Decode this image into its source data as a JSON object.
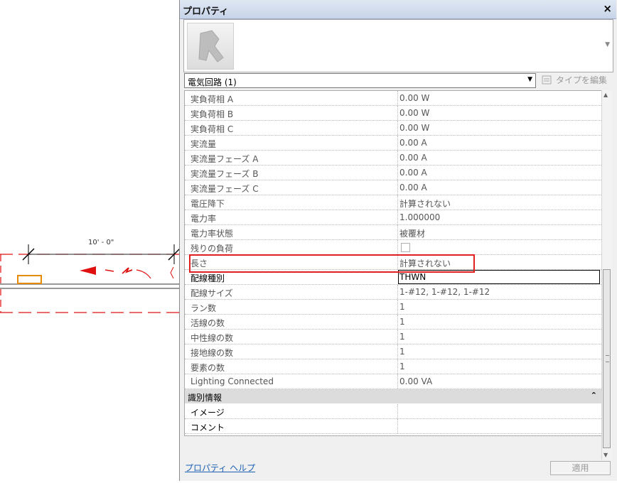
{
  "canvas": {
    "dimension_label": "10' - 0\""
  },
  "panel": {
    "title": "プロパティ",
    "close_label": "×",
    "selector": {
      "label": "電気回路 (1)",
      "arrow": "▾"
    },
    "edit_type": {
      "label": "タイプを編集",
      "icon": "edit-type-icon"
    },
    "rows": [
      {
        "name": "実負荷相 A",
        "value": "0.00 W"
      },
      {
        "name": "実負荷相 B",
        "value": "0.00 W"
      },
      {
        "name": "実負荷相 C",
        "value": "0.00 W"
      },
      {
        "name": "実流量",
        "value": "0.00 A"
      },
      {
        "name": "実流量フェーズ A",
        "value": "0.00 A"
      },
      {
        "name": "実流量フェーズ B",
        "value": "0.00 A"
      },
      {
        "name": "実流量フェーズ C",
        "value": "0.00 A"
      },
      {
        "name": "電圧降下",
        "value": "計算されない"
      },
      {
        "name": "電力率",
        "value": "1.000000"
      },
      {
        "name": "電力率状態",
        "value": "被覆材"
      },
      {
        "name": "残りの負荷",
        "value": ""
      },
      {
        "name": "長さ",
        "value": "計算されない"
      },
      {
        "name": "配線種別",
        "value": "THWN"
      },
      {
        "name": "配線サイズ",
        "value": "1-#12, 1-#12, 1-#12"
      },
      {
        "name": "ラン数",
        "value": "1"
      },
      {
        "name": "活線の数",
        "value": "1"
      },
      {
        "name": "中性線の数",
        "value": "1"
      },
      {
        "name": "接地線の数",
        "value": "1"
      },
      {
        "name": "要素の数",
        "value": "1"
      },
      {
        "name": "Lighting Connected",
        "value": "0.00 VA"
      }
    ],
    "group": {
      "label": "識別情報",
      "collapse_icon": "⌃"
    },
    "group_rows": [
      {
        "name": "イメージ",
        "value": ""
      },
      {
        "name": "コメント",
        "value": ""
      }
    ],
    "help_link": "プロパティ ヘルプ",
    "apply_button": "適用",
    "accent_color": "#e02020"
  }
}
